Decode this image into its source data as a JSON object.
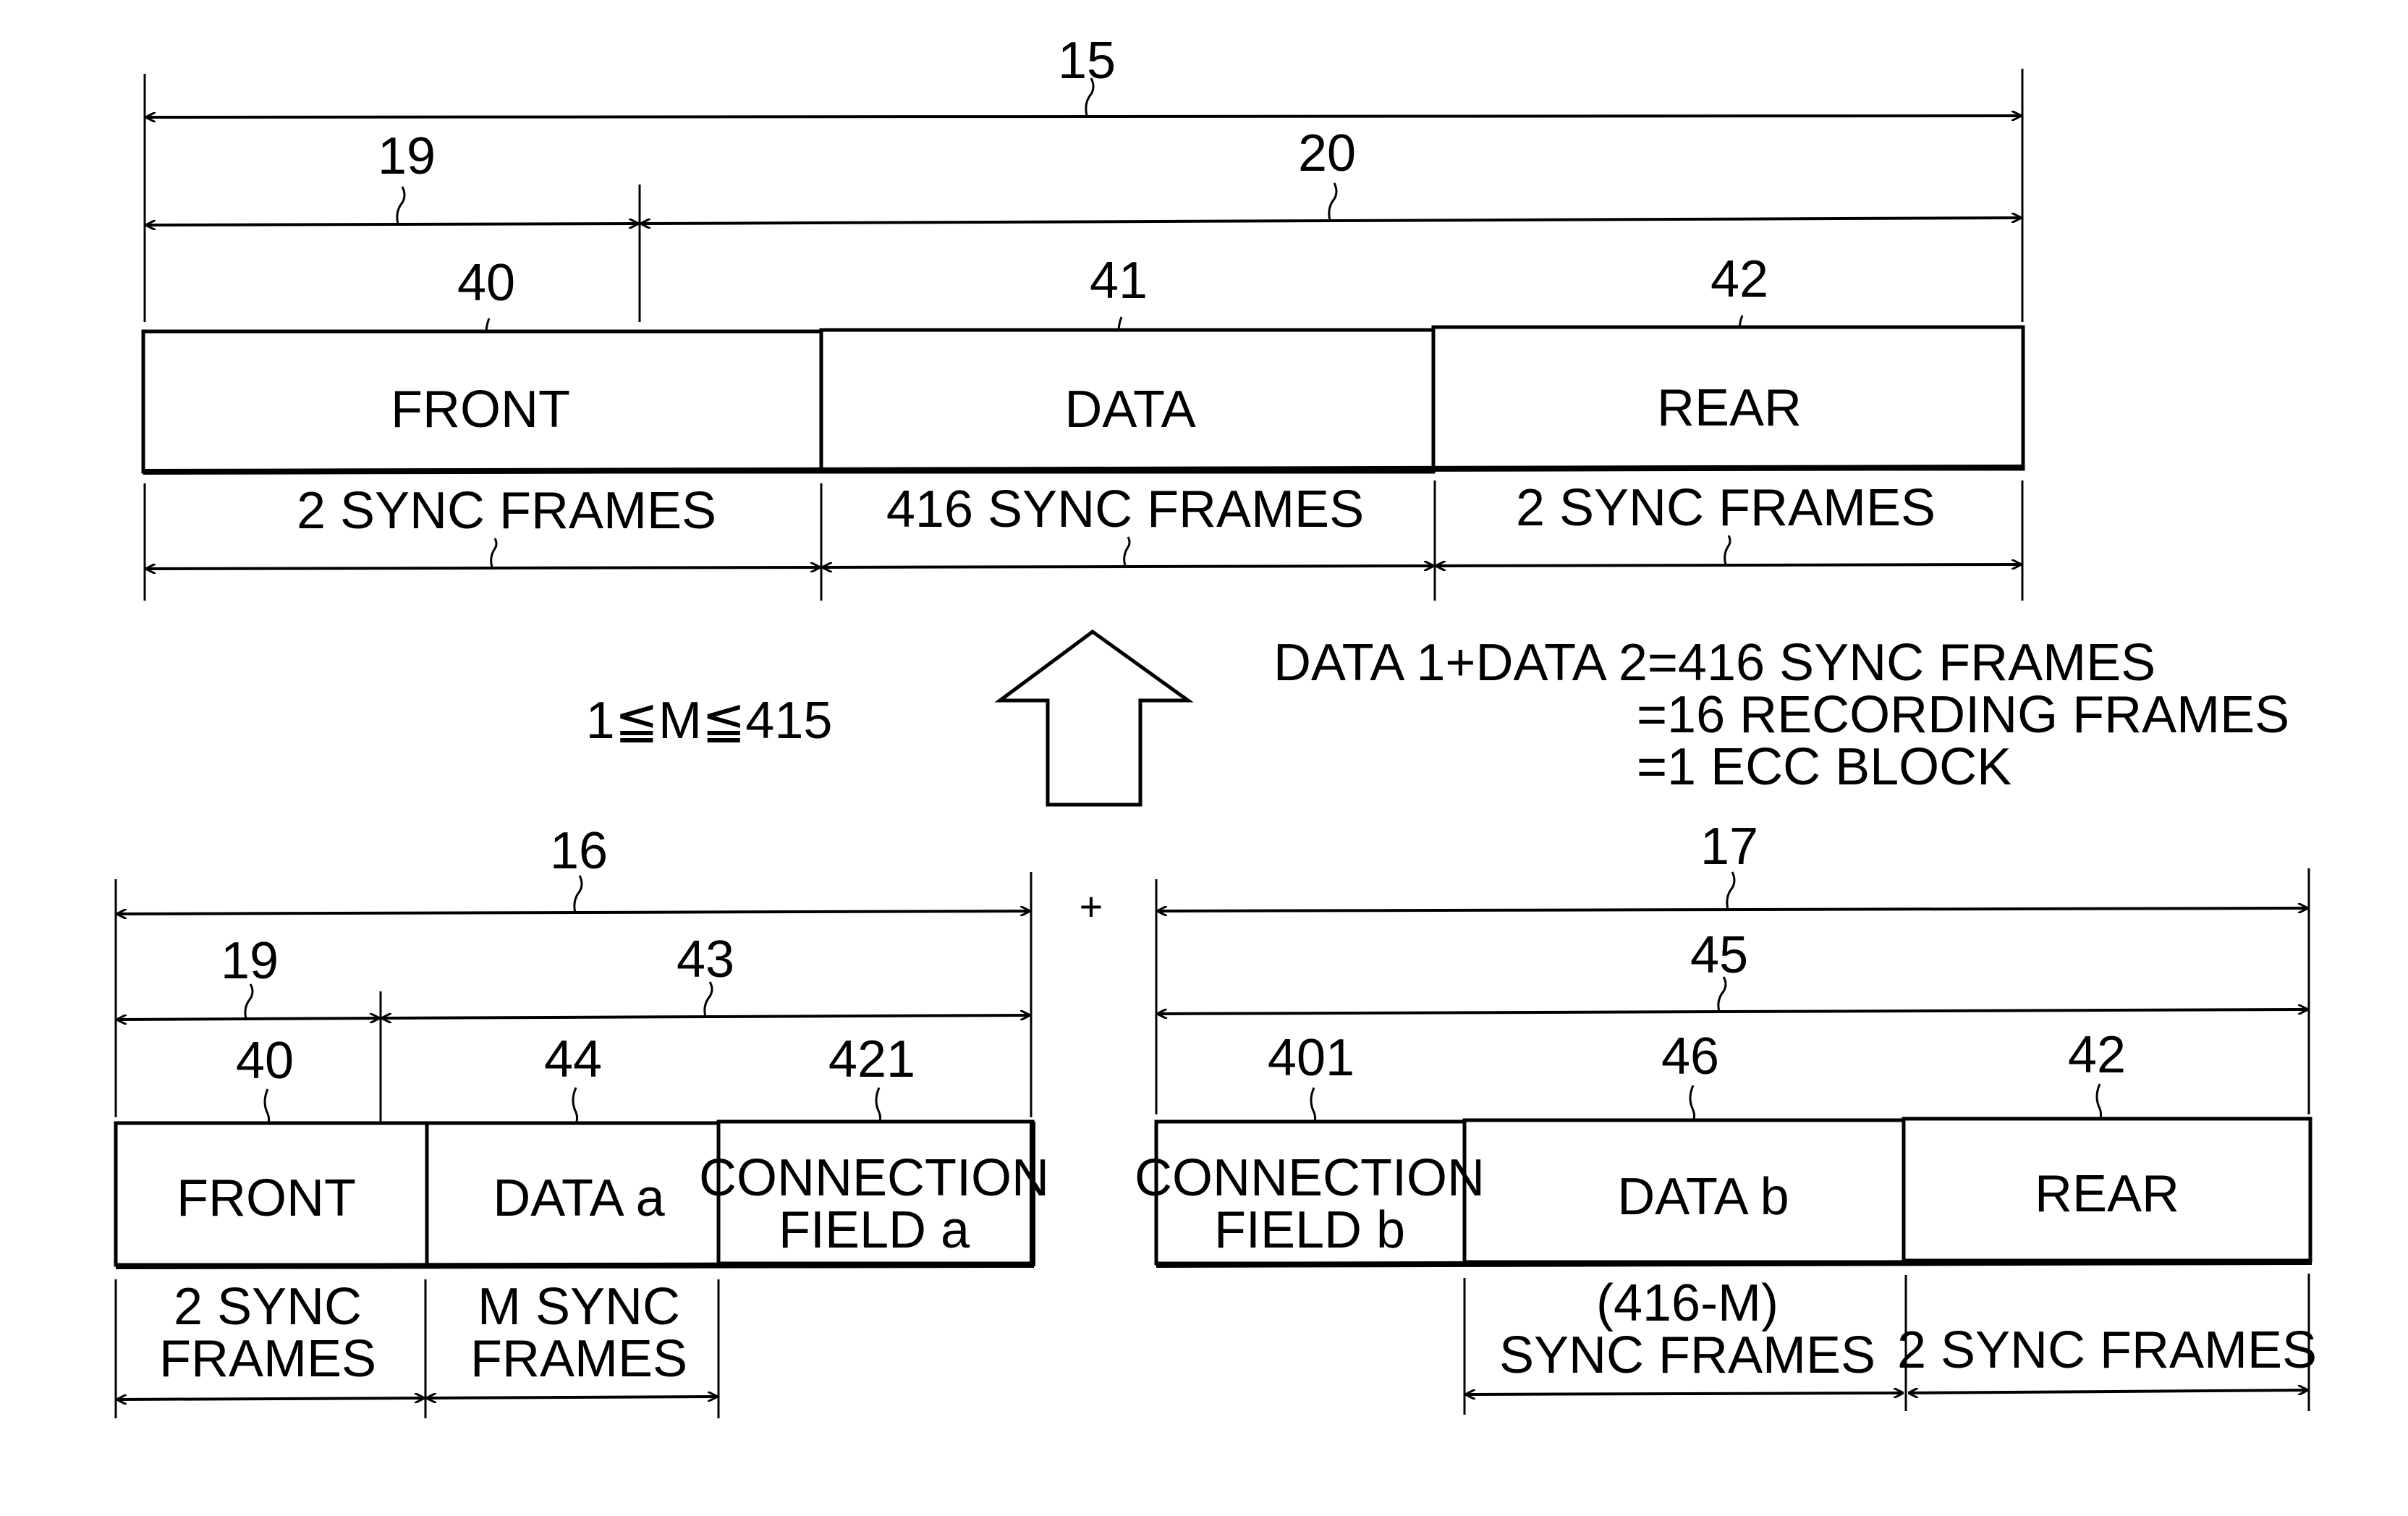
{
  "diagram": {
    "top": {
      "dims": {
        "total": "15",
        "front_span": "19",
        "rest_span": "20"
      },
      "cells": [
        {
          "ref": "40",
          "label": "FRONT",
          "size": "2 SYNC FRAMES"
        },
        {
          "ref": "41",
          "label": "DATA",
          "size": "416 SYNC FRAMES"
        },
        {
          "ref": "42",
          "label": "REAR",
          "size": "2 SYNC FRAMES"
        }
      ]
    },
    "middle": {
      "constraint": "1≦M≦415",
      "equation": [
        "DATA 1+DATA 2=416 SYNC FRAMES",
        "=16 RECORDING FRAMES",
        "=1 ECC BLOCK"
      ],
      "plus": "+"
    },
    "bottom_left": {
      "dims": {
        "total": "16",
        "front_span": "19",
        "rest_span": "43"
      },
      "cells": [
        {
          "ref": "40",
          "label": [
            "FRONT"
          ],
          "size": [
            "2 SYNC",
            "FRAMES"
          ]
        },
        {
          "ref": "44",
          "label": [
            "DATA a"
          ],
          "size": [
            "M SYNC",
            "FRAMES"
          ]
        },
        {
          "ref": "421",
          "label": [
            "CONNECTION",
            "FIELD a"
          ],
          "size": []
        }
      ]
    },
    "bottom_right": {
      "dims": {
        "total": "17",
        "span": "45"
      },
      "cells": [
        {
          "ref": "401",
          "label": [
            "CONNECTION",
            "FIELD b"
          ],
          "size": []
        },
        {
          "ref": "46",
          "label": [
            "DATA b"
          ],
          "size": [
            "(416-M)",
            "SYNC FRAMES"
          ]
        },
        {
          "ref": "42",
          "label": [
            "REAR"
          ],
          "size": [
            "2 SYNC FRAMES"
          ]
        }
      ]
    }
  }
}
